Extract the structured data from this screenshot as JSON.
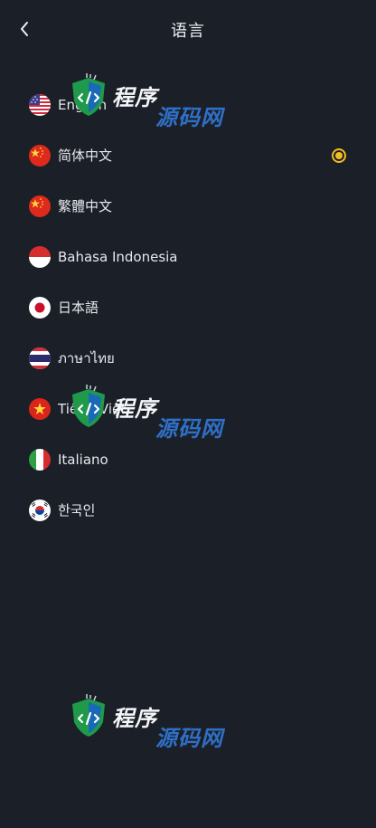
{
  "header": {
    "title": "语言",
    "back_icon": "chevron-left-icon"
  },
  "languages": [
    {
      "label": "English",
      "flag": "us-flag-icon",
      "selected": false
    },
    {
      "label": "简体中文",
      "flag": "china-flag-icon",
      "selected": true
    },
    {
      "label": "繁體中文",
      "flag": "china-flag-icon",
      "selected": false
    },
    {
      "label": "Bahasa Indonesia",
      "flag": "indonesia-flag-icon",
      "selected": false
    },
    {
      "label": "日本語",
      "flag": "japan-flag-icon",
      "selected": false
    },
    {
      "label": "ภาษาไทย",
      "flag": "thailand-flag-icon",
      "selected": false
    },
    {
      "label": "Tiếng Việt",
      "flag": "vietnam-flag-icon",
      "selected": false
    },
    {
      "label": "Italiano",
      "flag": "italy-flag-icon",
      "selected": false
    },
    {
      "label": "한국인",
      "flag": "korea-flag-icon",
      "selected": false
    }
  ],
  "watermark": {
    "text_part1": "程序",
    "text_part2": "源码网"
  },
  "colors": {
    "background": "#1b1f27",
    "accent": "#f2bd1f",
    "watermark_blue": "#2f6fc5"
  }
}
